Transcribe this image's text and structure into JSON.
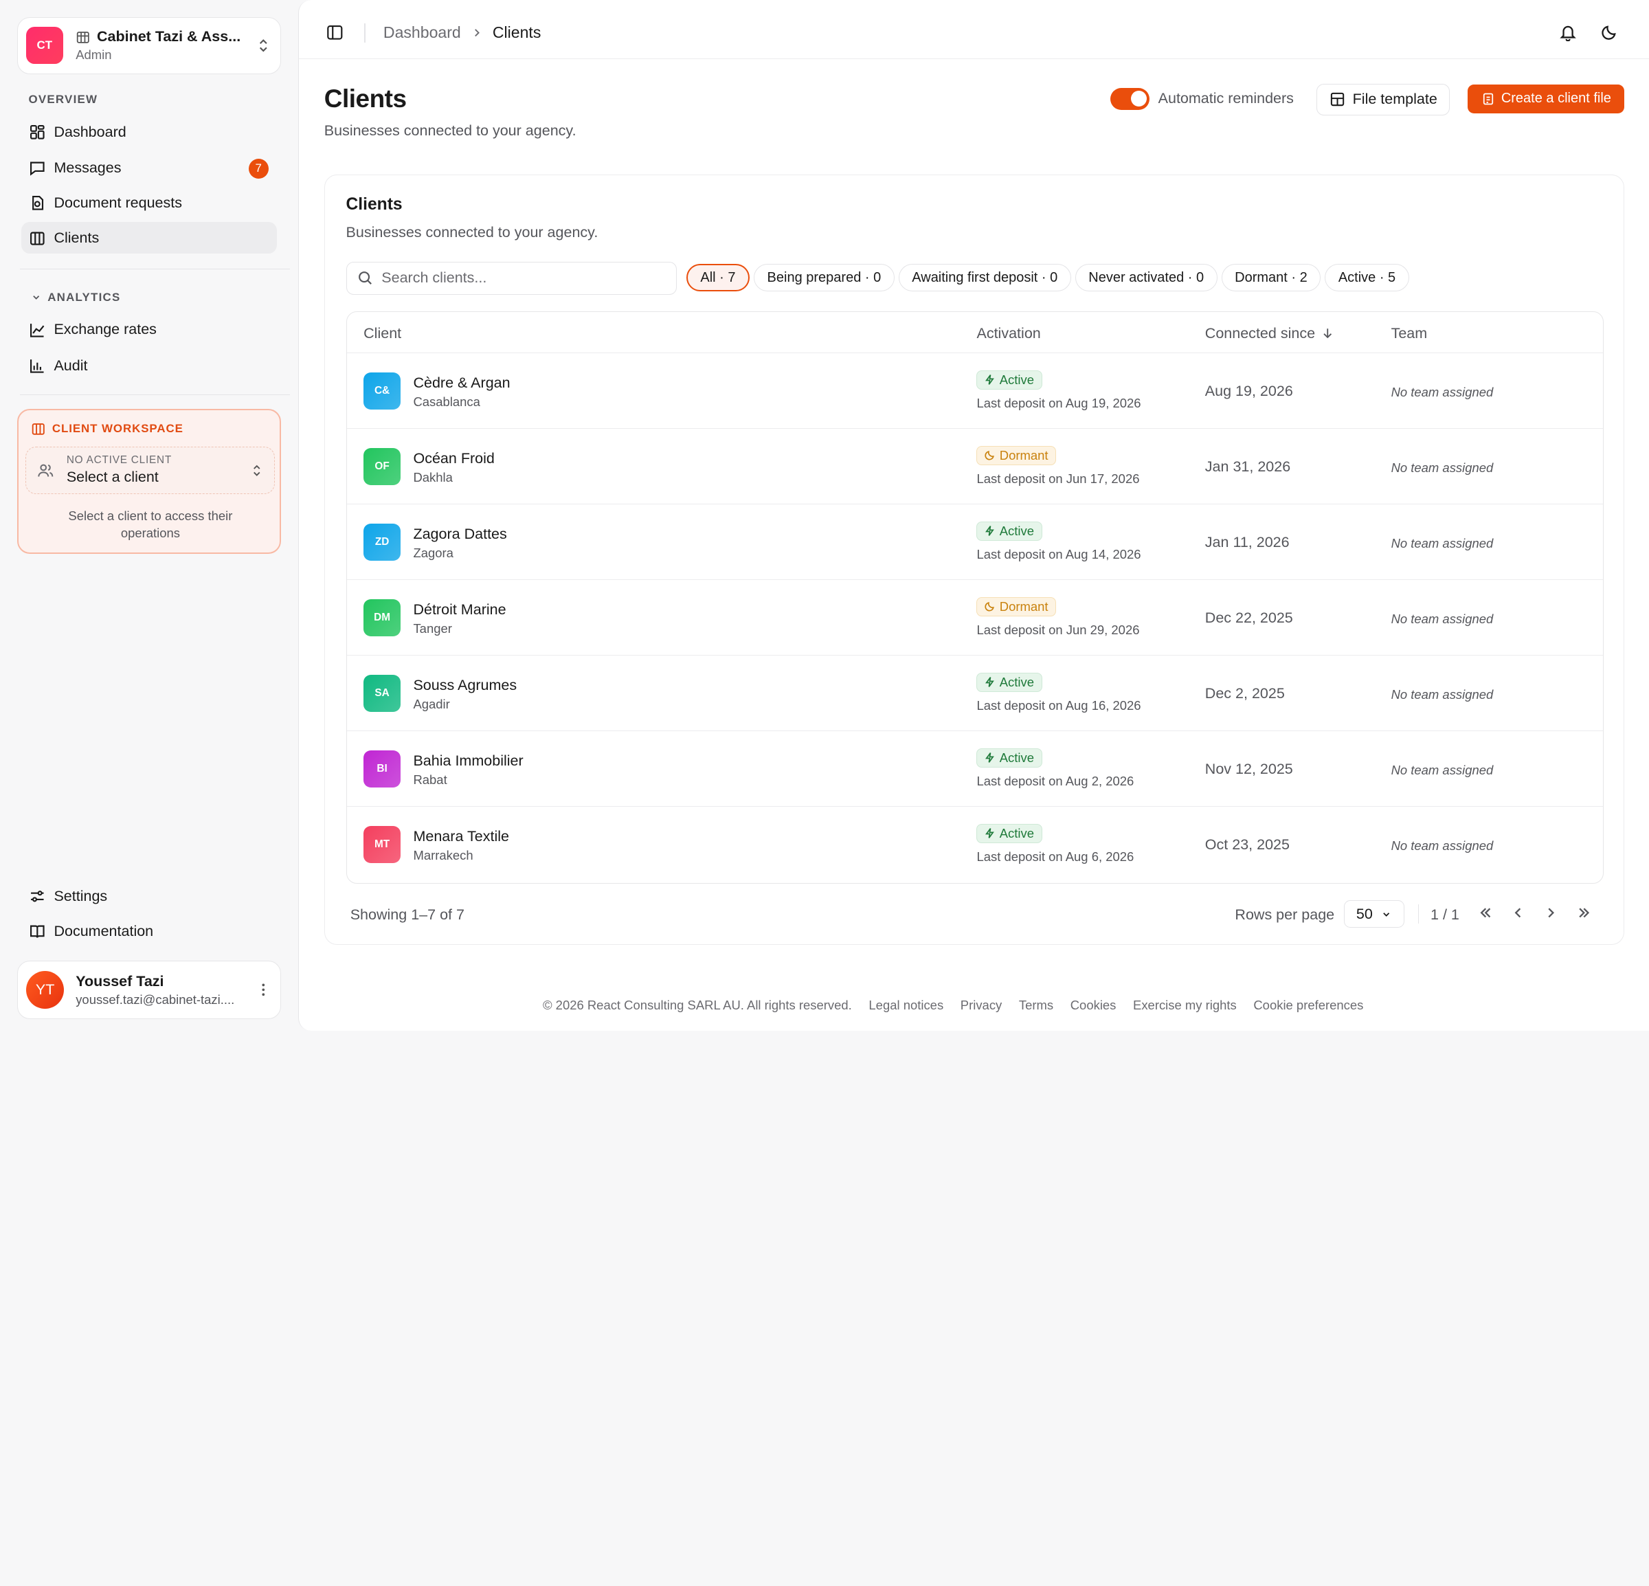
{
  "org": {
    "initials": "CT",
    "name": "Cabinet Tazi & Ass...",
    "role": "Admin"
  },
  "nav": {
    "overview_label": "OVERVIEW",
    "items": [
      {
        "label": "Dashboard",
        "icon": "grid-icon"
      },
      {
        "label": "Messages",
        "icon": "message-icon",
        "badge": "7"
      },
      {
        "label": "Document requests",
        "icon": "file-request-icon"
      },
      {
        "label": "Clients",
        "icon": "building-icon"
      }
    ],
    "analytics_label": "ANALYTICS",
    "analytics_items": [
      {
        "label": "Exchange rates",
        "icon": "line-chart-icon"
      },
      {
        "label": "Audit",
        "icon": "bar-chart-icon"
      }
    ],
    "bottom_items": [
      {
        "label": "Settings",
        "icon": "settings-icon"
      },
      {
        "label": "Documentation",
        "icon": "book-icon"
      }
    ]
  },
  "workspace": {
    "title": "CLIENT WORKSPACE",
    "select_caption": "NO ACTIVE CLIENT",
    "select_value": "Select a client",
    "help": "Select a client to access their operations"
  },
  "user": {
    "initials": "YT",
    "name": "Youssef Tazi",
    "email": "youssef.tazi@cabinet-tazi...."
  },
  "breadcrumb": {
    "parent": "Dashboard",
    "current": "Clients"
  },
  "page": {
    "title": "Clients",
    "subtitle": "Businesses connected to your agency.",
    "reminders_label": "Automatic reminders",
    "file_template_label": "File template",
    "create_label": "Create a client file"
  },
  "card": {
    "title": "Clients",
    "subtitle": "Businesses connected to your agency.",
    "search_placeholder": "Search clients...",
    "filters": [
      "All · 7",
      "Being prepared · 0",
      "Awaiting first deposit · 0",
      "Never activated · 0",
      "Dormant · 2",
      "Active · 5"
    ]
  },
  "table": {
    "headers": {
      "client": "Client",
      "activation": "Activation",
      "since": "Connected since",
      "team": "Team"
    },
    "rows": [
      {
        "initials": "C&",
        "name": "Cèdre & Argan",
        "city": "Casablanca",
        "status": "Active",
        "deposit": "Last deposit on Aug 19, 2026",
        "since": "Aug 19, 2026",
        "team": "No team assigned",
        "color": "#0ea5e9"
      },
      {
        "initials": "OF",
        "name": "Océan Froid",
        "city": "Dakhla",
        "status": "Dormant",
        "deposit": "Last deposit on Jun 17, 2026",
        "since": "Jan 31, 2026",
        "team": "No team assigned",
        "color": "#22c55e"
      },
      {
        "initials": "ZD",
        "name": "Zagora Dattes",
        "city": "Zagora",
        "status": "Active",
        "deposit": "Last deposit on Aug 14, 2026",
        "since": "Jan 11, 2026",
        "team": "No team assigned",
        "color": "#0ea5e9"
      },
      {
        "initials": "DM",
        "name": "Détroit Marine",
        "city": "Tanger",
        "status": "Dormant",
        "deposit": "Last deposit on Jun 29, 2026",
        "since": "Dec 22, 2025",
        "team": "No team assigned",
        "color": "#22c55e"
      },
      {
        "initials": "SA",
        "name": "Souss Agrumes",
        "city": "Agadir",
        "status": "Active",
        "deposit": "Last deposit on Aug 16, 2026",
        "since": "Dec 2, 2025",
        "team": "No team assigned",
        "color": "#10b981"
      },
      {
        "initials": "BI",
        "name": "Bahia Immobilier",
        "city": "Rabat",
        "status": "Active",
        "deposit": "Last deposit on Aug 2, 2026",
        "since": "Nov 12, 2025",
        "team": "No team assigned",
        "color": "#c026d3"
      },
      {
        "initials": "MT",
        "name": "Menara Textile",
        "city": "Marrakech",
        "status": "Active",
        "deposit": "Last deposit on Aug 6, 2026",
        "since": "Oct 23, 2025",
        "team": "No team assigned",
        "color": "#f43f5e"
      }
    ]
  },
  "pagination": {
    "showing": "Showing 1–7 of 7",
    "rows_label": "Rows per page",
    "rows_value": "50",
    "page": "1 / 1"
  },
  "footer": [
    "© 2026 React Consulting SARL AU. All rights reserved.",
    "Legal notices",
    "Privacy",
    "Terms",
    "Cookies",
    "Exercise my rights",
    "Cookie preferences"
  ],
  "colors": {
    "accent": "#ea4e0c",
    "active": "#1f7a3a",
    "dormant": "#c9820e"
  }
}
